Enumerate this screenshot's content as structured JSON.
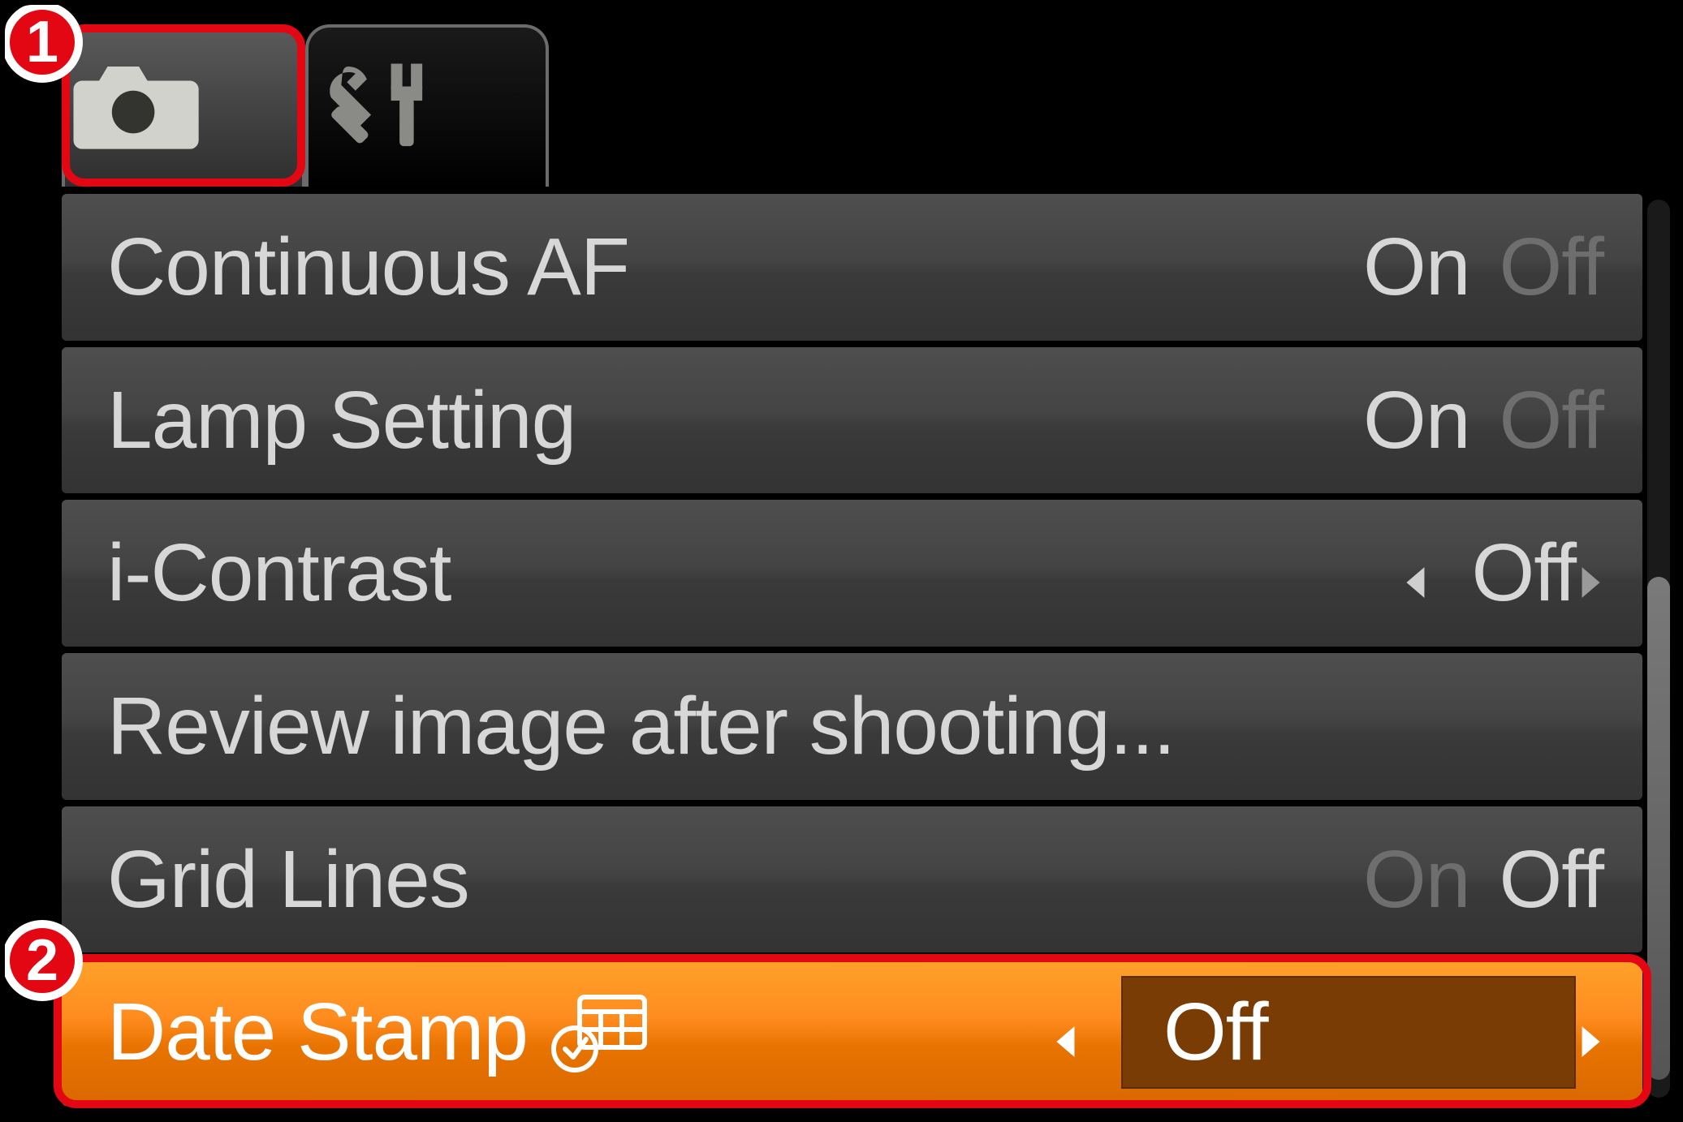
{
  "tabs": {
    "shooting_icon": "camera-icon",
    "setup_icon": "tools-icon",
    "active_index": 0
  },
  "callouts": {
    "one": "1",
    "two": "2"
  },
  "menu": {
    "items": [
      {
        "label": "Continuous AF",
        "on": "On",
        "off": "Off",
        "active_option": "on"
      },
      {
        "label": "Lamp Setting",
        "on": "On",
        "off": "Off",
        "active_option": "on"
      },
      {
        "label": "i-Contrast",
        "value": "Off",
        "selector": true
      },
      {
        "label": "Review image after shooting...",
        "link": true
      },
      {
        "label": "Grid Lines",
        "on": "On",
        "off": "Off",
        "active_option": "off"
      },
      {
        "label": "Date Stamp",
        "value": "Off",
        "selector": true,
        "highlighted": true,
        "icon": "date-stamp-icon"
      }
    ]
  }
}
